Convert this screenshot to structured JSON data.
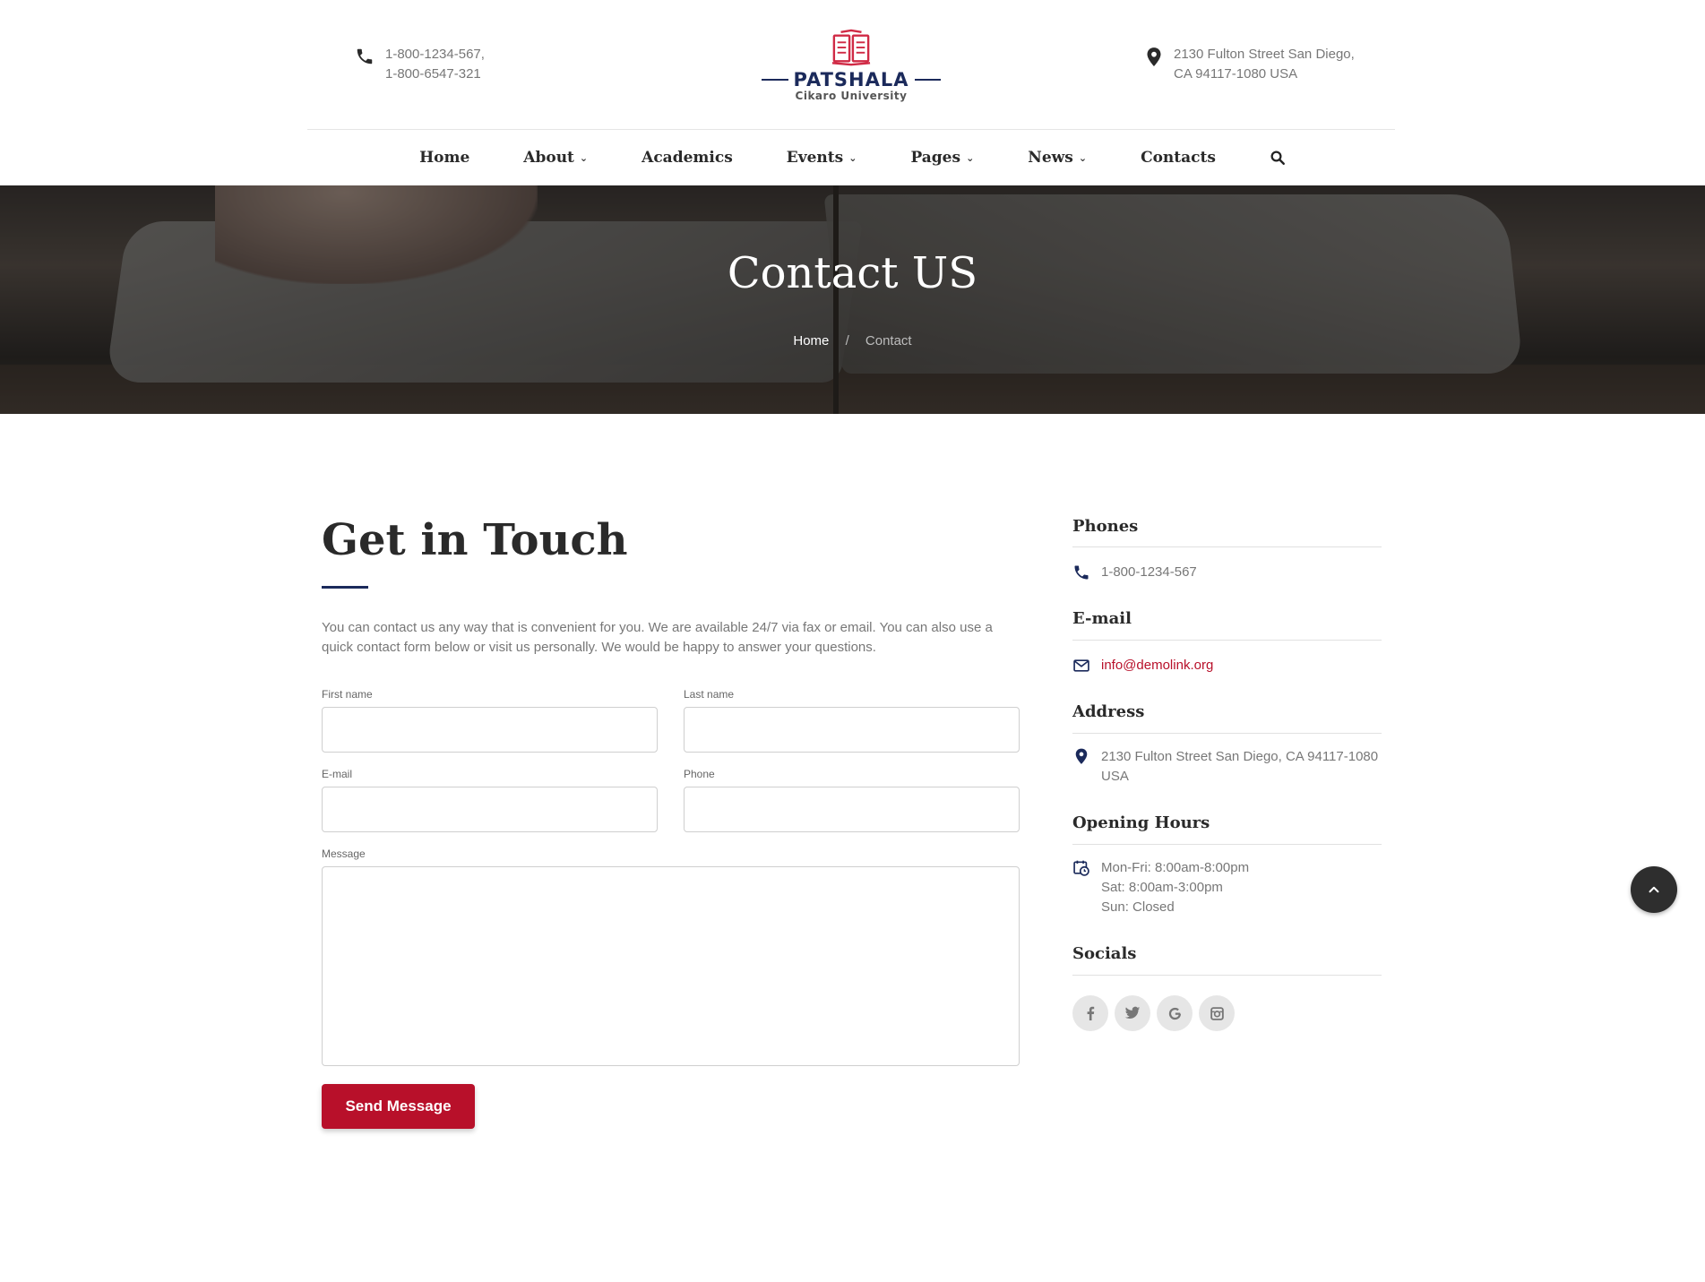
{
  "header": {
    "phones": [
      "1-800-1234-567,",
      "1-800-6547-321"
    ],
    "address": [
      "2130 Fulton Street San Diego,",
      "CA 94117-1080 USA"
    ],
    "logo": {
      "brand": "PATSHALA",
      "subtitle": "Cikaro University"
    }
  },
  "nav": {
    "items": [
      {
        "label": "Home",
        "dropdown": false
      },
      {
        "label": "About",
        "dropdown": true
      },
      {
        "label": "Academics",
        "dropdown": false
      },
      {
        "label": "Events",
        "dropdown": true
      },
      {
        "label": "Pages",
        "dropdown": true
      },
      {
        "label": "News",
        "dropdown": true
      },
      {
        "label": "Contacts",
        "dropdown": false
      }
    ],
    "chevron": "⌄"
  },
  "hero": {
    "title": "Contact US",
    "breadcrumb": {
      "home": "Home",
      "separator": "/",
      "current": "Contact"
    }
  },
  "contact": {
    "title": "Get in Touch",
    "intro": "You can contact us any way that is convenient for you. We are available 24/7 via fax or email. You can also use a quick contact form below or visit us personally. We would be happy to answer your questions.",
    "form": {
      "first_name_label": "First name",
      "last_name_label": "Last name",
      "email_label": "E-mail",
      "phone_label": "Phone",
      "message_label": "Message",
      "first_name_value": "",
      "last_name_value": "",
      "email_value": "",
      "phone_value": "",
      "message_value": "",
      "submit": "Send Message"
    }
  },
  "sidebar": {
    "phones_heading": "Phones",
    "phone": "1-800-1234-567",
    "email_heading": "E-mail",
    "email": "info@demolink.org",
    "address_heading": "Address",
    "address": [
      "2130 Fulton Street San Diego, CA 94117-1080",
      "USA"
    ],
    "hours_heading": "Opening Hours",
    "hours": [
      "Mon-Fri: 8:00am-8:00pm",
      "Sat: 8:00am-3:00pm",
      "Sun: Closed"
    ],
    "socials_heading": "Socials",
    "socials": [
      {
        "name": "facebook-icon",
        "glyph": "f"
      },
      {
        "name": "twitter-icon",
        "glyph": "t"
      },
      {
        "name": "google-icon",
        "glyph": "G"
      },
      {
        "name": "instagram-icon",
        "glyph": "◎"
      }
    ]
  },
  "colors": {
    "brand_navy": "#1b2a5b",
    "brand_red": "#b8102a",
    "text_dark": "#2a2a2a",
    "text_muted": "#777777"
  }
}
